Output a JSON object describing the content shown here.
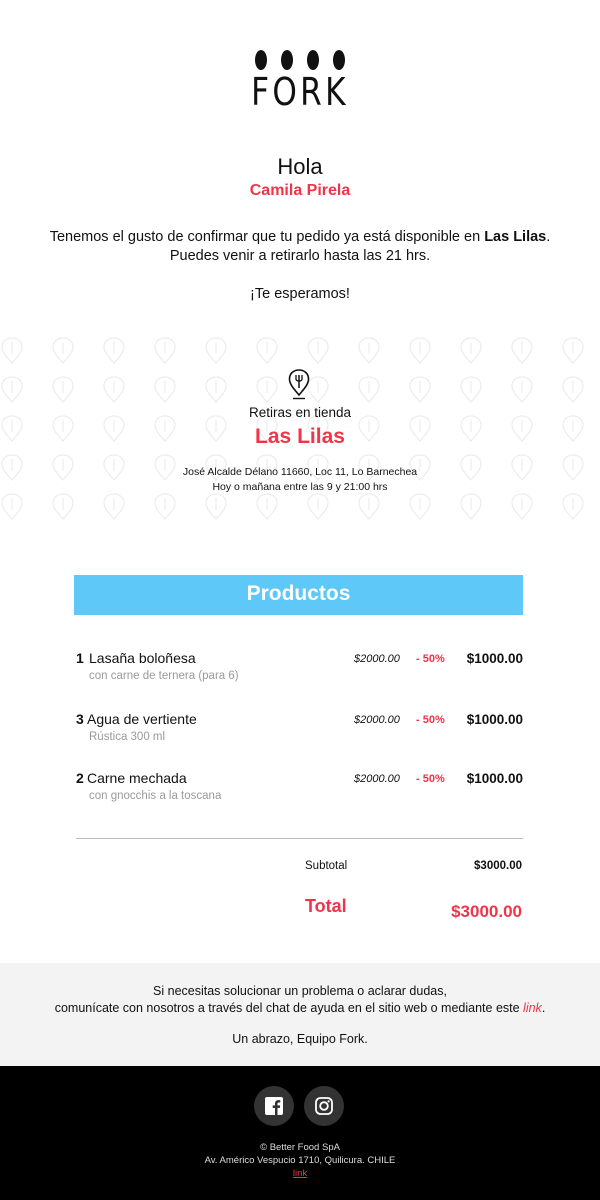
{
  "brand": {
    "logo_text": "FORK"
  },
  "greeting": {
    "hello": "Hola",
    "customer_name": "Camila Pirela"
  },
  "message": {
    "line1_before": "Tenemos el gusto de confirmar que tu pedido ya está disponible en ",
    "line1_store": "Las Lilas",
    "line1_after": ".",
    "line2": "Puedes venir a retirarlo hasta las 21 hrs.",
    "closing": "¡Te esperamos!"
  },
  "pickup": {
    "icon": "fork-pin-icon",
    "label": "Retiras en tienda",
    "store": "Las Lilas",
    "address": "José Alcalde Délano 11660, Loc 11, Lo Barnechea",
    "schedule": "Hoy o mañana entre las 9 y 21:00 hrs"
  },
  "products": {
    "header": "Productos",
    "items": [
      {
        "qty": "1",
        "name": "Lasaña boloñesa",
        "desc": "con carne de ternera (para 6)",
        "original_price": "$2000.00",
        "discount": "- 50%",
        "price": "$1000.00"
      },
      {
        "qty": "3",
        "name": "Agua de vertiente",
        "desc": "Rústica 300 ml",
        "original_price": "$2000.00",
        "discount": "- 50%",
        "price": "$1000.00"
      },
      {
        "qty": "2",
        "name": "Carne mechada",
        "desc": "con gnocchis a la toscana",
        "original_price": "$2000.00",
        "discount": "- 50%",
        "price": "$1000.00"
      }
    ],
    "subtotal_label": "Subtotal",
    "subtotal": "$3000.00",
    "total_label": "Total",
    "total": "$3000.00"
  },
  "help": {
    "line1": "Si necesitas solucionar un problema o aclarar dudas,",
    "line2_before": "comunícate con nosotros a través del chat de ayuda en el sitio web o mediante este ",
    "line2_link": "link",
    "line2_after": ".",
    "signoff": "Un abrazo, Equipo Fork."
  },
  "footer": {
    "social": [
      "facebook-icon",
      "instagram-icon"
    ],
    "company": "© Better Food SpA",
    "address": "Av. Américo Vespucio 1710, Quilicura. CHILE",
    "link": "link"
  },
  "colors": {
    "accent": "#f0344a",
    "header_bg": "#5ec8f8",
    "help_bg": "#f3f3f3",
    "footer_bg": "#000000"
  }
}
